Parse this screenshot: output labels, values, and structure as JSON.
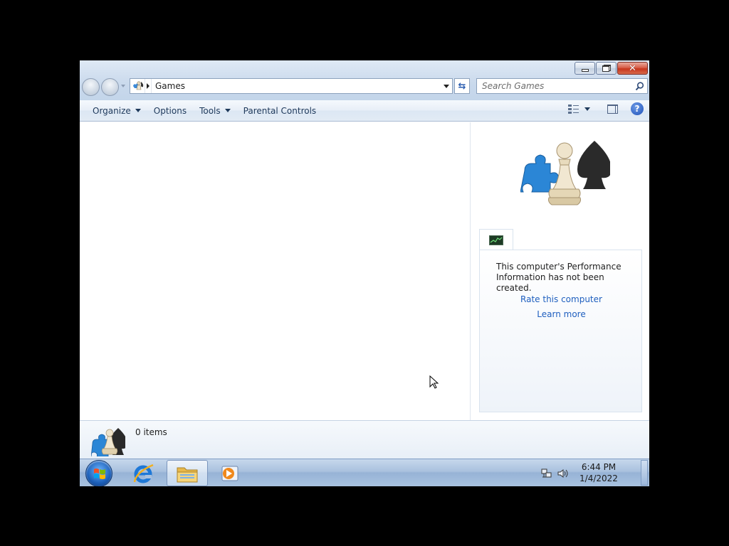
{
  "window": {
    "caption": {
      "minimize_label": "Minimize",
      "maximize_label": "Restore",
      "close_label": "Close"
    },
    "address_bar": {
      "path_label": "Games"
    },
    "search": {
      "placeholder": "Search Games"
    },
    "command_bar": {
      "items": [
        {
          "label": "Organize",
          "has_dropdown": true
        },
        {
          "label": "Options",
          "has_dropdown": false
        },
        {
          "label": "Tools",
          "has_dropdown": true
        },
        {
          "label": "Parental Controls",
          "has_dropdown": false
        }
      ]
    },
    "preview_pane": {
      "performance_message": "This computer's Performance Information has not been created.",
      "links": {
        "rate": "Rate this computer",
        "learn": "Learn more"
      }
    },
    "details_pane": {
      "item_count": "0 items"
    }
  },
  "taskbar": {
    "clock": {
      "time": "6:44 PM",
      "date": "1/4/2022"
    }
  },
  "colors": {
    "frame": "#c9d9ec",
    "link": "#1f5fbf",
    "taskbar": "#a9c1de"
  }
}
